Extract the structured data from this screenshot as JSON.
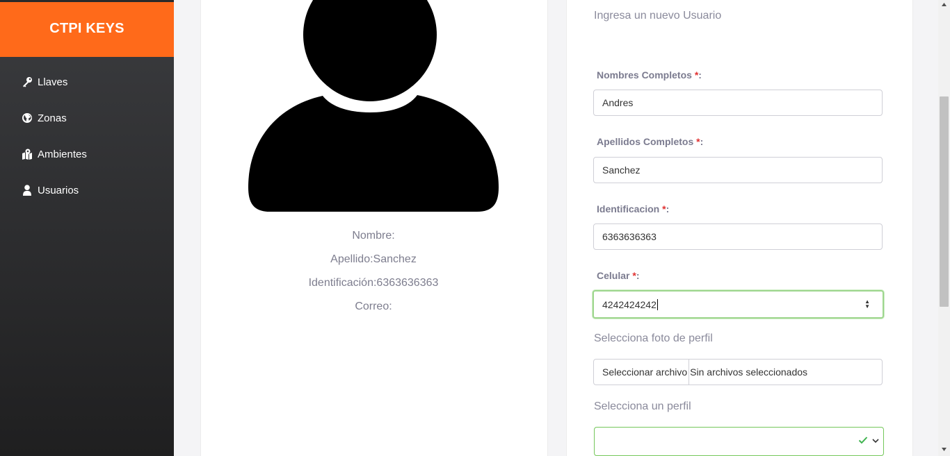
{
  "brand": "CTPI KEYS",
  "nav": [
    {
      "label": "Llaves",
      "icon": "key-icon"
    },
    {
      "label": "Zonas",
      "icon": "globe-icon"
    },
    {
      "label": "Ambientes",
      "icon": "map-marker-icon"
    },
    {
      "label": "Usuarios",
      "icon": "user-icon"
    }
  ],
  "profile": {
    "nombre": "Nombre:",
    "apellido": "Apellido:Sanchez",
    "identificacion": "Identificación:6363636363",
    "correo": "Correo:"
  },
  "form": {
    "title": "Ingresa un nuevo Usuario",
    "required_mark": "*",
    "fields": {
      "nombres": {
        "label": "Nombres Completos ",
        "value": "Andres"
      },
      "apellidos": {
        "label": "Apellidos Completos ",
        "value": "Sanchez"
      },
      "identificacion": {
        "label": "Identificacion ",
        "value": "6363636363"
      },
      "celular": {
        "label": "Celular ",
        "value": "4242424242"
      }
    },
    "foto_label": "Selecciona foto de perfil",
    "file_button": "Seleccionar archivo",
    "file_status": "Sin archivos seleccionados",
    "perfil_label": "Selecciona un perfil",
    "perfil_value": ""
  },
  "colors": {
    "brand": "#ff6a1a",
    "valid": "#74c75a",
    "required": "#e03131"
  }
}
